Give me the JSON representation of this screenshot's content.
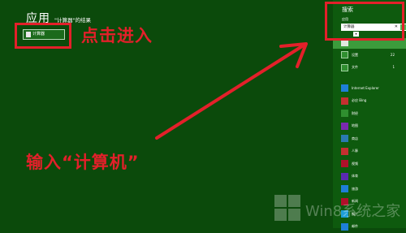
{
  "app": {
    "heading": "应用",
    "subheading": "\"计算器\"的结果",
    "result_label": "计算器"
  },
  "annotations": {
    "click_enter": "点击进入",
    "type_calc": "输入“计算机”",
    "color": "#e3202a"
  },
  "charm": {
    "title": "搜索",
    "scope": "应用",
    "search_value": "计算器",
    "clear_glyph": "✕",
    "go_glyph": "⌕",
    "caret_glyph": "▾",
    "categories": [
      {
        "icon": "gear-icon",
        "label": "设置",
        "count": "22",
        "color": "#2f8f2f"
      },
      {
        "icon": "file-icon",
        "label": "文件",
        "count": "1",
        "color": "#2f8f2f"
      }
    ],
    "apps": [
      {
        "icon": "ie-icon",
        "label": "Internet Explorer",
        "color": "#1e7fd8"
      },
      {
        "icon": "bing-icon",
        "label": "必应 Bing",
        "color": "#c53030"
      },
      {
        "icon": "finance-icon",
        "label": "财经",
        "color": "#2f8f2f"
      },
      {
        "icon": "games-icon",
        "label": "地图",
        "color": "#7a2ab0"
      },
      {
        "icon": "store-icon",
        "label": "商店",
        "color": "#2a7ab0"
      },
      {
        "icon": "people-icon",
        "label": "人脉",
        "color": "#c53030"
      },
      {
        "icon": "video-icon",
        "label": "视频",
        "color": "#b0102a"
      },
      {
        "icon": "sport-icon",
        "label": "体育",
        "color": "#5a2ab0"
      },
      {
        "icon": "travel-icon",
        "label": "旅游",
        "color": "#1e7fd8"
      },
      {
        "icon": "news-icon",
        "label": "新闻",
        "color": "#b0102a"
      },
      {
        "icon": "photos-icon",
        "label": "照片",
        "color": "#1e9fd8"
      },
      {
        "icon": "mail-icon",
        "label": "邮件",
        "color": "#1e7fd8"
      }
    ]
  },
  "watermark": "Win8系统之家"
}
